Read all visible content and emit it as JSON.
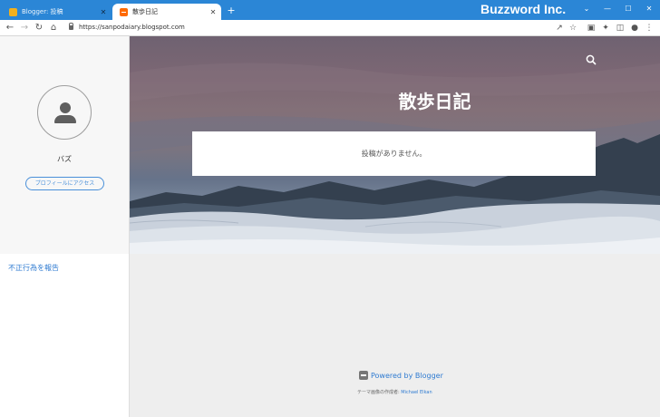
{
  "browser": {
    "tabs": [
      {
        "title": "Blogger: 投稿",
        "close": "✕"
      },
      {
        "title": "散歩日記",
        "close": "✕"
      }
    ],
    "new_tab": "+",
    "brand": "Buzzword Inc.",
    "window_controls": {
      "dropdown": "⌄",
      "minimize": "—",
      "maximize": "☐",
      "close": "✕"
    },
    "url": "https://sanpodaiary.blogspot.com",
    "colors": {
      "titlebar": "#2b86d6",
      "link": "#2f7bd1"
    }
  },
  "sidebar": {
    "profile_name": "バズ",
    "profile_button": "プロフィールにアクセス",
    "report_link": "不正行為を報告"
  },
  "hero": {
    "blog_title": "散歩日記",
    "empty_message": "投稿がありません。"
  },
  "footer": {
    "powered": "Powered by Blogger",
    "credit_prefix": "テーマ画像の作成者:",
    "credit_author": "Michael Elkan"
  }
}
